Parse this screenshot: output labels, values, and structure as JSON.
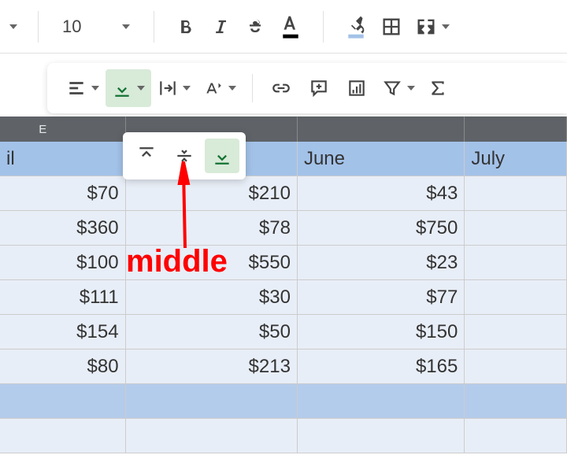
{
  "toolbar1": {
    "font_size": "10"
  },
  "column_letters": "E",
  "headers": {
    "col0": "il",
    "col1": "",
    "col2": "June",
    "col3": "July"
  },
  "rows": [
    {
      "c0": "$70",
      "c1": "$210",
      "c2": "$43",
      "c3": ""
    },
    {
      "c0": "$360",
      "c1": "$78",
      "c2": "$750",
      "c3": ""
    },
    {
      "c0": "$100",
      "c1": "$550",
      "c2": "$23",
      "c3": ""
    },
    {
      "c0": "$111",
      "c1": "$30",
      "c2": "$77",
      "c3": ""
    },
    {
      "c0": "$154",
      "c1": "$50",
      "c2": "$150",
      "c3": ""
    },
    {
      "c0": "$80",
      "c1": "$213",
      "c2": "$165",
      "c3": ""
    }
  ],
  "annotation": {
    "label": "middle"
  }
}
